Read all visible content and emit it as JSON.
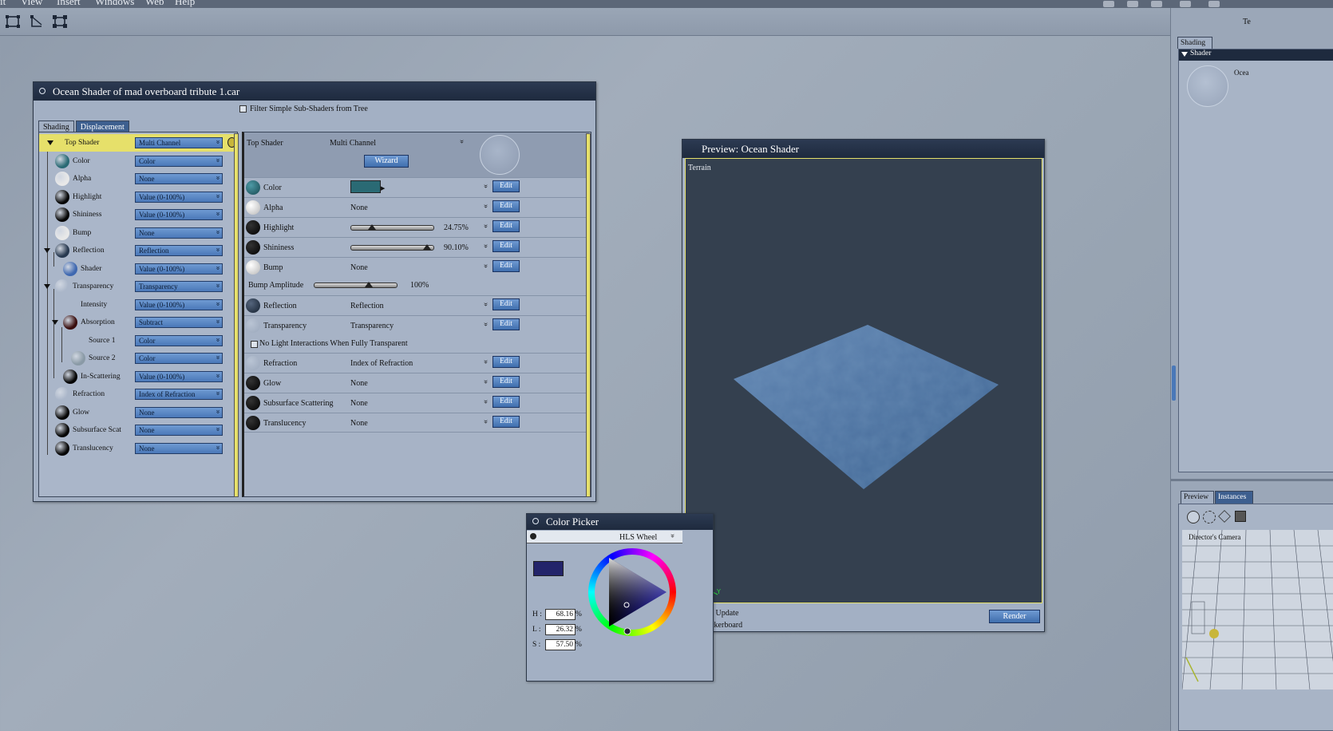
{
  "menubar": {
    "items": [
      "it",
      "View",
      "Insert",
      "Windows",
      "Web",
      "Help"
    ]
  },
  "shader_window": {
    "title": "Ocean Shader of mad overboard tribute 1.car",
    "filter_label": "Filter Simple Sub-Shaders from Tree",
    "tabs": [
      "Shading",
      "Displacement"
    ],
    "tree": [
      {
        "label": "Top Shader",
        "value": "Multi Channel",
        "ball": "#e6e06a"
      },
      {
        "label": "Color",
        "value": "Color",
        "ball": "#2a6a74"
      },
      {
        "label": "Alpha",
        "value": "None",
        "ball": "#e8e8e8"
      },
      {
        "label": "Highlight",
        "value": "Value (0-100%)",
        "ball": "#050505"
      },
      {
        "label": "Shininess",
        "value": "Value (0-100%)",
        "ball": "#050505"
      },
      {
        "label": "Bump",
        "value": "None",
        "ball": "#e8e8e8"
      },
      {
        "label": "Reflection",
        "value": "Reflection",
        "ball": "#27384f"
      },
      {
        "label": "Shader",
        "value": "Value (0-100%)",
        "ball": "#3f68b0"
      },
      {
        "label": "Transparency",
        "value": "Transparency",
        "ball": "#aab6c9"
      },
      {
        "label": "Intensity",
        "value": "Value (0-100%)",
        "ball": "none"
      },
      {
        "label": "Absorption",
        "value": "Subtract",
        "ball": "#3a0e0e"
      },
      {
        "label": "Source 1",
        "value": "Color",
        "ball": "none"
      },
      {
        "label": "Source 2",
        "value": "Color",
        "ball": "#8a9aa6"
      },
      {
        "label": "In-Scattering",
        "value": "Value (0-100%)",
        "ball": "#050505"
      },
      {
        "label": "Refraction",
        "value": "Index of Refraction",
        "ball": "#aab6c9"
      },
      {
        "label": "Glow",
        "value": "None",
        "ball": "#050505"
      },
      {
        "label": "Subsurface Scat",
        "value": "None",
        "ball": "#050505"
      },
      {
        "label": "Translucency",
        "value": "None",
        "ball": "#050505"
      }
    ],
    "props": {
      "top_shader_label": "Top Shader",
      "top_shader_value": "Multi Channel",
      "wizard": "Wizard",
      "edit": "Edit",
      "color": "Color",
      "alpha": "Alpha",
      "alpha_value": "None",
      "highlight": "Highlight",
      "highlight_value": "24.75%",
      "highlight_pct": 24.75,
      "shininess": "Shininess",
      "shininess_value": "90.10%",
      "shininess_pct": 90.1,
      "bump": "Bump",
      "bump_value": "None",
      "bump_amp": "Bump Amplitude",
      "bump_amp_value": "100%",
      "reflection": "Reflection",
      "reflection_value": "Reflection",
      "transparency": "Transparency",
      "transparency_value": "Transparency",
      "no_light": "No Light Interactions When Fully Transparent",
      "refraction": "Refraction",
      "refraction_value": "Index of Refraction",
      "glow": "Glow",
      "glow_value": "None",
      "sss": "Subsurface Scattering",
      "sss_value": "None",
      "translucency": "Translucency",
      "translucency_value": "None"
    }
  },
  "preview": {
    "title": "Preview: Ocean Shader",
    "object": "Terrain",
    "auto_update": "Auto Update",
    "checkerboard": "Checkerboard",
    "render": "Render"
  },
  "color_picker": {
    "title": "Color Picker",
    "mode": "HLS Wheel",
    "h_label": "H :",
    "h": "68.16",
    "l_label": "L :",
    "l": "26.32",
    "s_label": "S :",
    "s": "57.50",
    "pct": "%",
    "swatch": "#23246a"
  },
  "dock": {
    "tab_shading": "Shading",
    "shader_header": "Shader",
    "ocean_text": "Ocea",
    "tab_preview": "Preview",
    "tab_instances": "Instances",
    "camera_text": "Director's Camera",
    "top_text": "Te"
  }
}
